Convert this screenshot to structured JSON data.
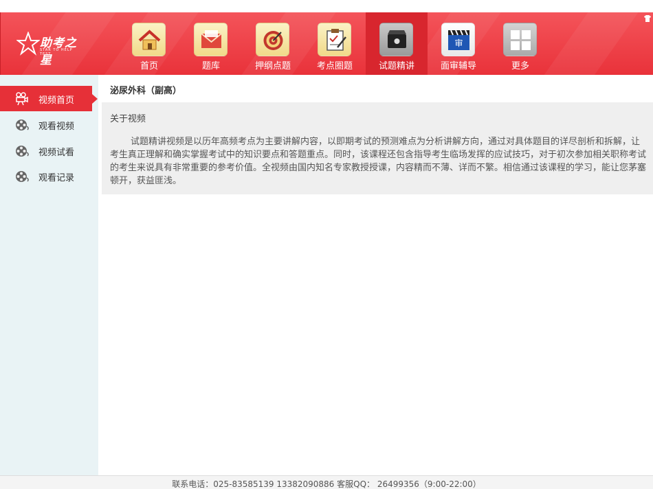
{
  "app": {
    "logo_text": "助考之星",
    "logo_sub": "STAR TO HELP TEST"
  },
  "nav": {
    "items": [
      {
        "label": "首页",
        "icon": "home-icon"
      },
      {
        "label": "题库",
        "icon": "mail-icon"
      },
      {
        "label": "押纲点题",
        "icon": "target-icon"
      },
      {
        "label": "考点圈题",
        "icon": "clipboard-icon"
      },
      {
        "label": "试题精讲",
        "icon": "video-camera-icon",
        "active": true
      },
      {
        "label": "面审辅导",
        "icon": "clapperboard-icon"
      },
      {
        "label": "更多",
        "icon": "grid-icon"
      }
    ],
    "clapper_text": "审"
  },
  "sidebar": {
    "items": [
      {
        "label": "视频首页",
        "icon": "projector-icon",
        "active": true
      },
      {
        "label": "观看视频",
        "icon": "film-reel-icon"
      },
      {
        "label": "视频试看",
        "icon": "film-reel-icon"
      },
      {
        "label": "观看记录",
        "icon": "film-reel-icon"
      }
    ]
  },
  "main": {
    "title": "泌尿外科（副高）",
    "about_title": "关于视频",
    "about_body": "试题精讲视频是以历年高频考点为主要讲解内容，以即期考试的预测难点为分析讲解方向，通过对具体题目的详尽剖析和拆解，让考生真正理解和确实掌握考试中的知识要点和答题重点。同时，该课程还包含指导考生临场发挥的应试技巧，对于初次参加相关职称考试的考生来说具有非常重要的参考价值。全视频由国内知名专家教授授课，内容精而不薄、详而不繁。相信通过该课程的学习，能让您茅塞顿开，获益匪浅。"
  },
  "footer": {
    "text": "联系电话：025-83585139  13382090886  客服QQ：  26499356（9:00-22:00）"
  },
  "colors": {
    "header_red": "#e9323a",
    "active_red": "#d8262e",
    "sidebar_bg": "#e9f3f5"
  }
}
